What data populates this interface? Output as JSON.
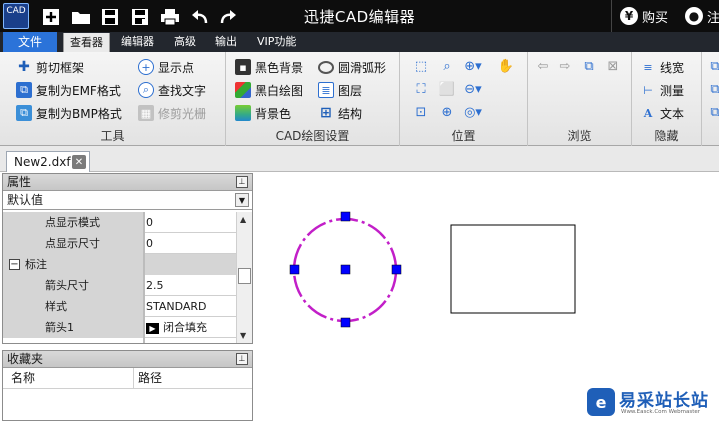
{
  "window": {
    "app_logo_text": "CAD",
    "title": "迅捷CAD编辑器",
    "buy_label": "购买",
    "login_label": "注"
  },
  "menu": {
    "file_label": "文件",
    "tabs": [
      "查看器",
      "编辑器",
      "高级",
      "输出",
      "VIP功能"
    ]
  },
  "ribbon": {
    "tools": {
      "label": "工具",
      "items": [
        "剪切框架",
        "复制为EMF格式",
        "复制为BMP格式",
        "显示点",
        "查找文字",
        "修剪光栅"
      ]
    },
    "cad_settings": {
      "label": "CAD绘图设置",
      "items": [
        "黑色背景",
        "黑白绘图",
        "背景色",
        "圆滑弧形",
        "图层",
        "结构"
      ]
    },
    "position": {
      "label": "位置"
    },
    "browse": {
      "label": "浏览"
    },
    "hide": {
      "label": "隐藏",
      "items": [
        "线宽",
        "测量",
        "文本"
      ]
    }
  },
  "document": {
    "tab_name": "New2.dxf"
  },
  "properties": {
    "title": "属性",
    "dropdown_value": "默认值",
    "rows": [
      {
        "name": "点显示模式",
        "value": "0"
      },
      {
        "name": "点显示尺寸",
        "value": "0"
      },
      {
        "name": "标注",
        "value": ""
      },
      {
        "name": "箭头尺寸",
        "value": "2.5"
      },
      {
        "name": "样式",
        "value": "STANDARD"
      },
      {
        "name": "箭头1",
        "value": "闭合填充"
      }
    ]
  },
  "favorites": {
    "title": "收藏夹",
    "col_name": "名称",
    "col_path": "路径"
  },
  "watermark": {
    "title": "易采站长站",
    "url": "Www.Easck.Com Webmaster"
  },
  "colors": {
    "titlebar": "#0d0d0d",
    "file_tab": "#2b73d9",
    "circle": "#c21fc8",
    "grip": "#0000ff"
  }
}
